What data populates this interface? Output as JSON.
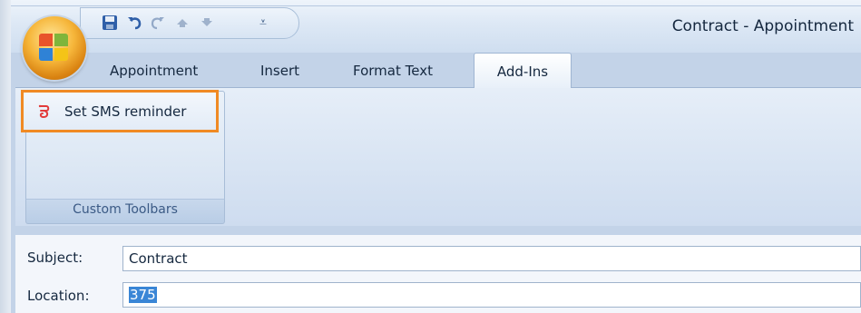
{
  "window": {
    "title": "Contract - Appointment"
  },
  "quick_access": {
    "items": [
      "save-icon",
      "undo-icon",
      "redo-icon",
      "previous-item-icon",
      "next-item-icon",
      "customize-toolbar-icon"
    ],
    "menu_glyph": "⩡"
  },
  "ribbon": {
    "tabs": [
      {
        "label": "Appointment"
      },
      {
        "label": "Insert"
      },
      {
        "label": "Format Text"
      },
      {
        "label": "Add-Ins",
        "active": true
      }
    ],
    "group": {
      "label": "Custom Toolbars",
      "button_label": "Set SMS reminder",
      "highlight_color": "#f08a24"
    }
  },
  "form": {
    "subject_label": "Subject:",
    "subject_value": "Contract",
    "location_label": "Location:",
    "location_value": "375"
  },
  "colors": {
    "ribbon_bg": "#dbe6f4",
    "accent_orange": "#f08a24",
    "selection_blue": "#3a86d6"
  }
}
